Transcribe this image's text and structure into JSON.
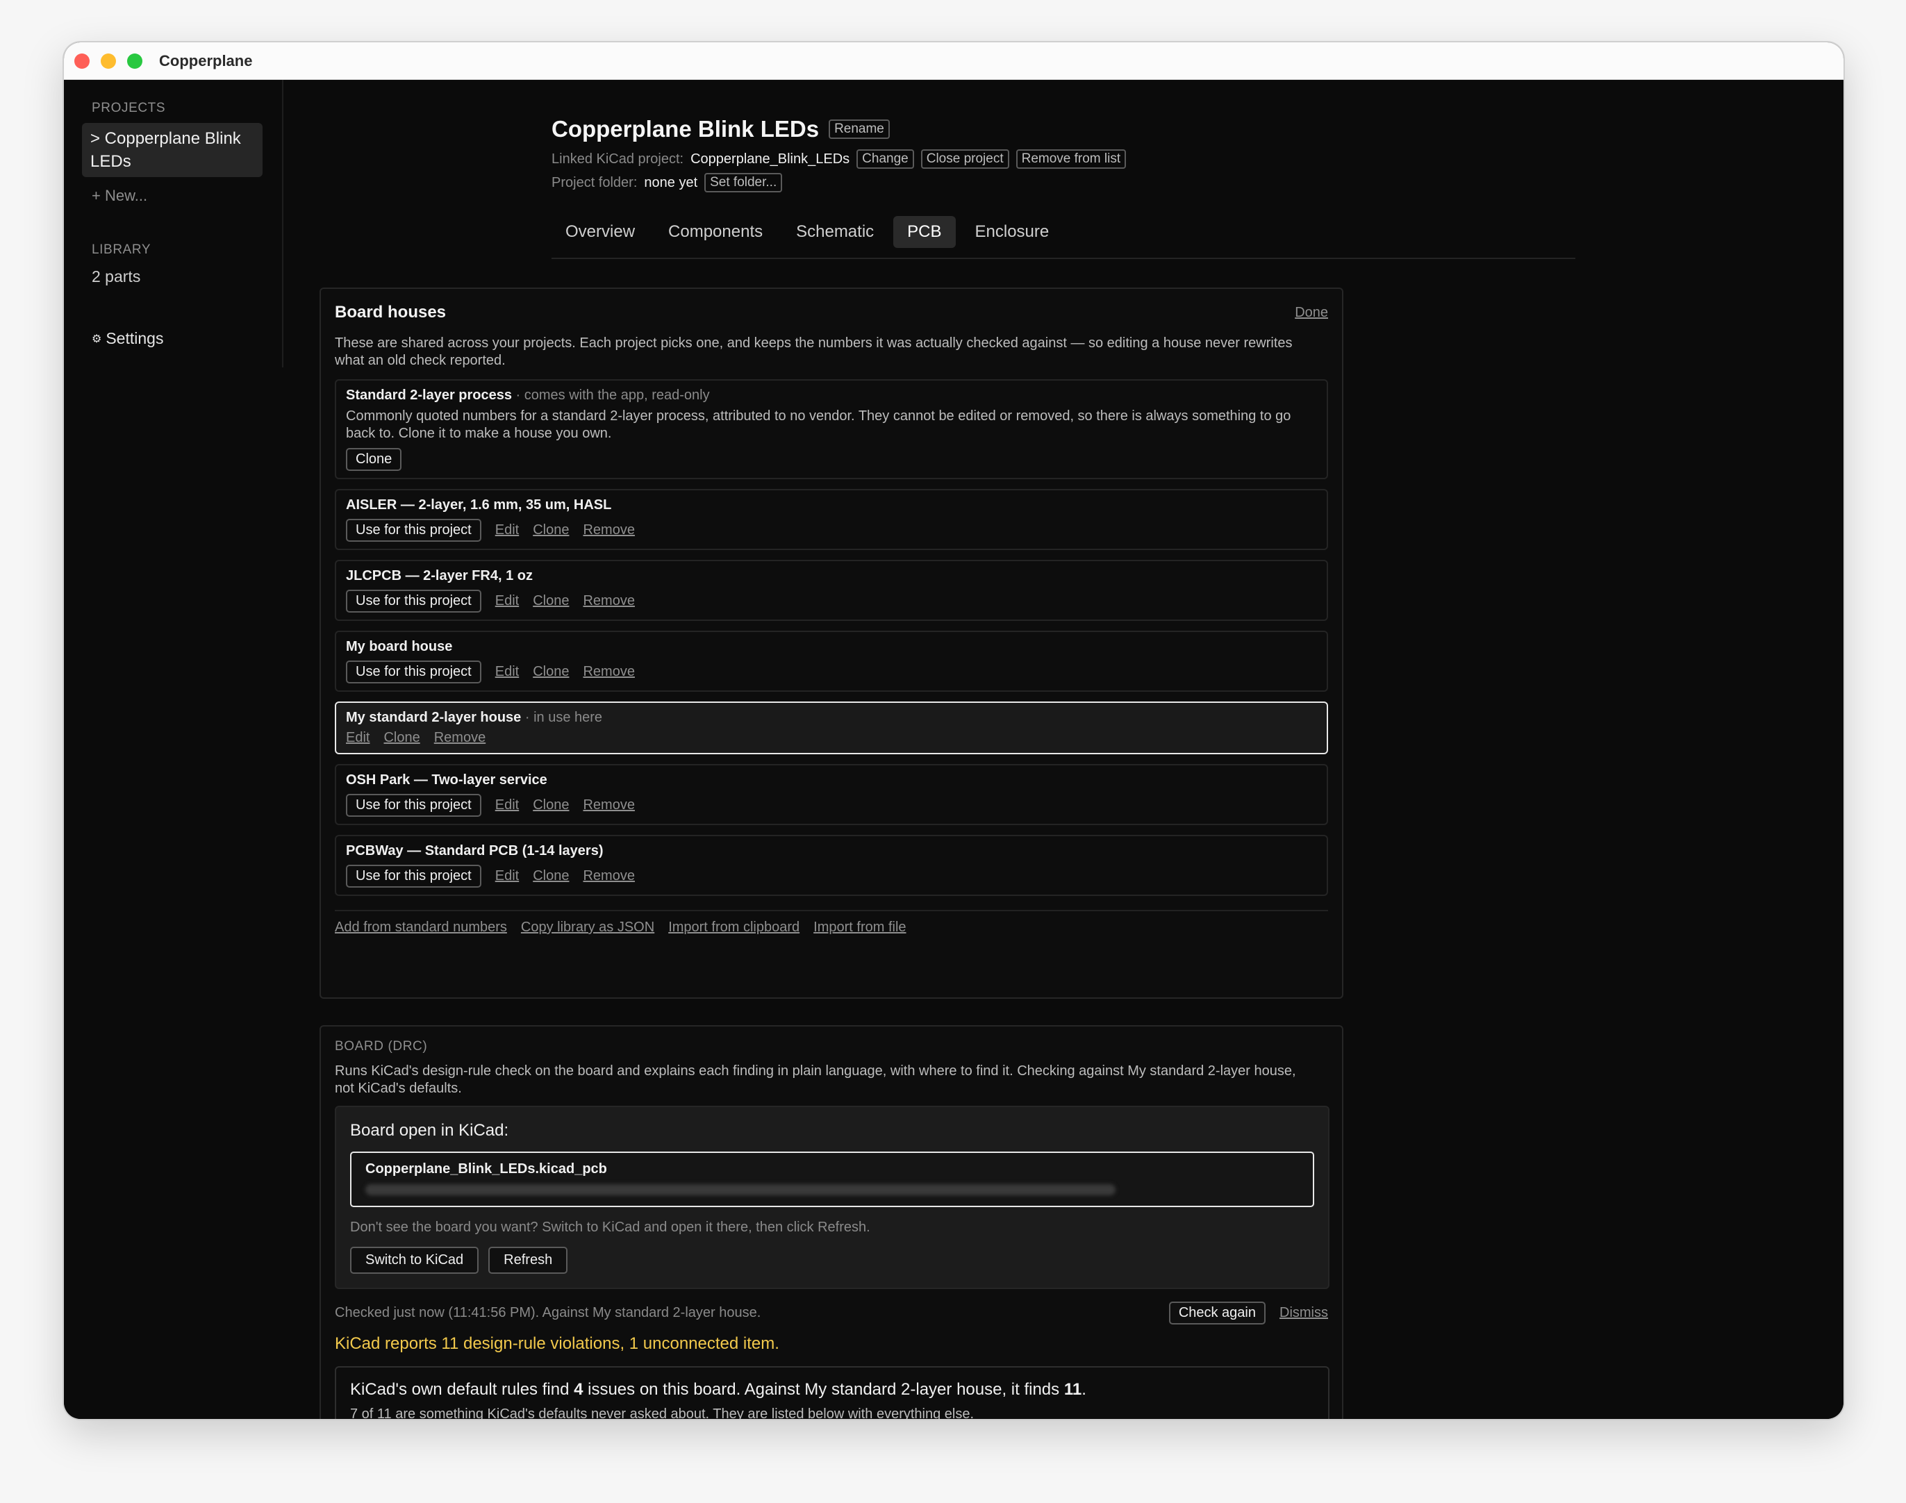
{
  "window": {
    "title": "Copperplane"
  },
  "sidebar": {
    "projects_heading": "PROJECTS",
    "active_project": "> Copperplane Blink LEDs",
    "new_label": "+ New...",
    "library_heading": "LIBRARY",
    "library_count": "2 parts",
    "settings_icon": "⚙",
    "settings_label": "Settings"
  },
  "header": {
    "title": "Copperplane Blink LEDs",
    "rename": "Rename",
    "linked_label": "Linked KiCad project:",
    "linked_value": "Copperplane_Blink_LEDs",
    "change": "Change",
    "close_project": "Close project",
    "remove_from_list": "Remove from list",
    "folder_label": "Project folder:",
    "folder_value": "none yet",
    "set_folder": "Set folder..."
  },
  "tabs": [
    {
      "label": "Overview"
    },
    {
      "label": "Components"
    },
    {
      "label": "Schematic"
    },
    {
      "label": "PCB"
    },
    {
      "label": "Enclosure"
    }
  ],
  "houses_panel": {
    "title": "Board houses",
    "done": "Done",
    "description": "These are shared across your projects. Each project picks one, and keeps the numbers it was actually checked against — so editing a house never rewrites what an old check reported.",
    "standard": {
      "name": "Standard 2-layer process",
      "sub": " · comes with the app, read-only",
      "desc": "Commonly quoted numbers for a standard 2-layer process, attributed to no vendor. They cannot be edited or removed, so there is always something to go back to. Clone it to make a house you own.",
      "clone": "Clone"
    },
    "houses": [
      {
        "name": "AISLER — 2-layer, 1.6 mm, 35 um, HASL",
        "use": "Use for this project",
        "edit": "Edit",
        "clone": "Clone",
        "remove": "Remove"
      },
      {
        "name": "JLCPCB — 2-layer FR4, 1 oz",
        "use": "Use for this project",
        "edit": "Edit",
        "clone": "Clone",
        "remove": "Remove"
      },
      {
        "name": "My board house",
        "use": "Use for this project",
        "edit": "Edit",
        "clone": "Clone",
        "remove": "Remove"
      }
    ],
    "current": {
      "name": "My standard 2-layer house",
      "sub": " · in use here",
      "edit": "Edit",
      "clone": "Clone",
      "remove": "Remove"
    },
    "houses_after": [
      {
        "name": "OSH Park — Two-layer service",
        "use": "Use for this project",
        "edit": "Edit",
        "clone": "Clone",
        "remove": "Remove"
      },
      {
        "name": "PCBWay — Standard PCB (1-14 layers)",
        "use": "Use for this project",
        "edit": "Edit",
        "clone": "Clone",
        "remove": "Remove"
      }
    ],
    "footer": {
      "add_standard": "Add from standard numbers",
      "copy_json": "Copy library as JSON",
      "import_clipboard": "Import from clipboard",
      "import_file": "Import from file"
    }
  },
  "drc": {
    "heading": "BOARD (DRC)",
    "description": "Runs KiCad's design-rule check on the board and explains each finding in plain language, with where to find it. Checking against My standard 2-layer house, not KiCad's defaults.",
    "board_label": "Board open in KiCad:",
    "board_file": "Copperplane_Blink_LEDs.kicad_pcb",
    "hint": "Don't see the board you want? Switch to KiCad and open it there, then click Refresh.",
    "switch": "Switch to KiCad",
    "refresh": "Refresh",
    "checked": "Checked just now (11:41:56 PM). Against My standard 2-layer house.",
    "check_again": "Check again",
    "dismiss": "Dismiss",
    "warning": "KiCad reports 11 design-rule violations, 1 unconnected item.",
    "result_a": "KiCad's own default rules find ",
    "result_b": "4",
    "result_c": " issues on this board. Against My standard 2-layer house, it finds ",
    "result_d": "11",
    "result_e": ".",
    "result_sub": "7 of 11 are something KiCad's defaults never asked about. They are listed below with everything else."
  }
}
